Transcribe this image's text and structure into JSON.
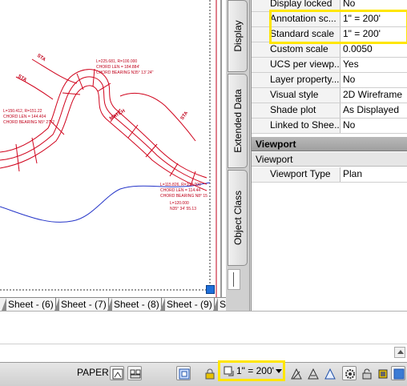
{
  "sheet_tabs": [
    "Sheet - (6)",
    "Sheet - (7)",
    "Sheet - (8)",
    "Sheet - (9)",
    "Sheet"
  ],
  "side_tabs": [
    "Display",
    "Extended Data",
    "Object Class"
  ],
  "properties": [
    {
      "name": "Display locked",
      "value": "No"
    },
    {
      "name": "Annotation sc...",
      "value": "1\" = 200'"
    },
    {
      "name": "Standard scale",
      "value": "1\" = 200'"
    },
    {
      "name": "Custom scale",
      "value": "0.0050"
    },
    {
      "name": "UCS per viewp...",
      "value": "Yes"
    },
    {
      "name": "Layer property...",
      "value": "No"
    },
    {
      "name": "Visual style",
      "value": "2D Wireframe"
    },
    {
      "name": "Shade plot",
      "value": "As Displayed"
    },
    {
      "name": "Linked to Shee...",
      "value": "No"
    }
  ],
  "viewport_section": {
    "category": "Viewport",
    "subcategory": "Viewport",
    "row": {
      "name": "Viewport Type",
      "value": "Plan"
    }
  },
  "statusbar": {
    "paper_label": "PAPER",
    "scale_value": "1\" = 200'"
  },
  "drawing_labels": [
    "L=225.681, R=100.000",
    "CHORD LEN = 184.884'",
    "CHORD BEARING N35° 13' 24\"",
    "L=150.412, R=151.22",
    "CHORD LEN = 144.404",
    "CHORD BEARING N5° 27' 2",
    "L=115.826, R=100.000",
    "CHORD LEN = 114.44",
    "CHORD BEARING N8° 15",
    "L=120.000",
    "N35° 34' 55.13"
  ],
  "colors": {
    "highlight": "#ffe600",
    "drawing_lines": "#d0021b",
    "drawing_text": "#c0001a",
    "terrain_line": "#2434c8",
    "viewport_handle": "#1e6fd9"
  }
}
